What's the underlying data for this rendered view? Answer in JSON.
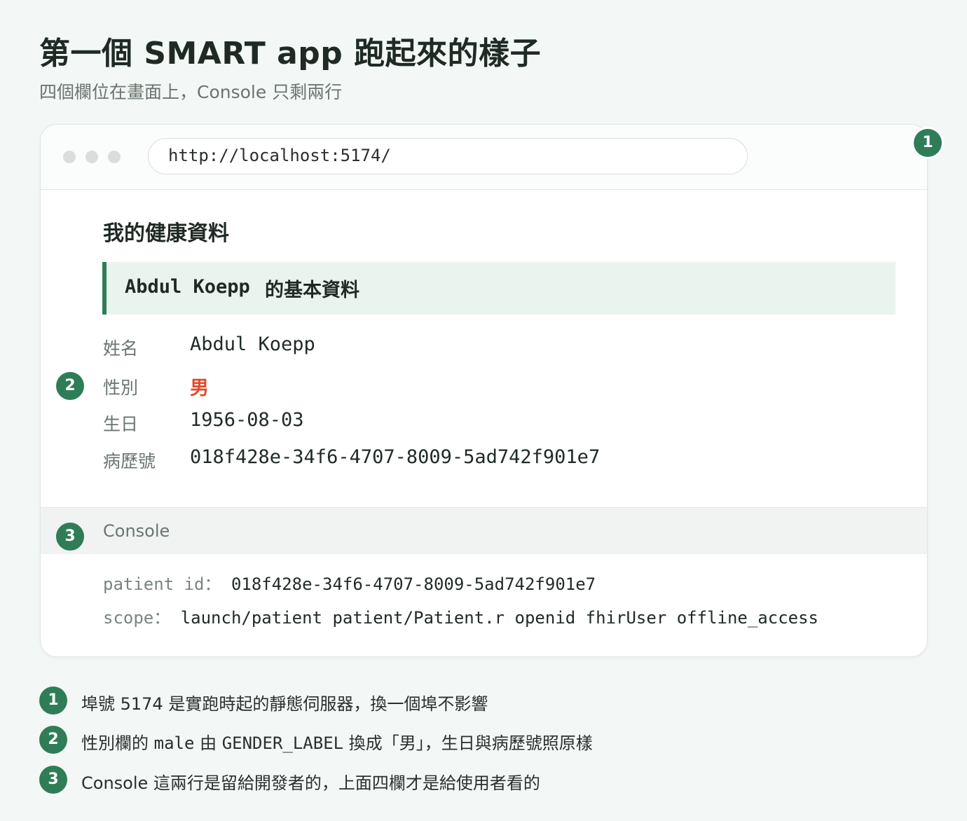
{
  "page": {
    "title": "第一個 SMART app 跑起來的樣子",
    "subtitle": "四個欄位在畫面上，Console 只剩兩行"
  },
  "browser": {
    "url": "http://localhost:5174/"
  },
  "app": {
    "heading": "我的健康資料",
    "banner_name": "Abdul Koepp",
    "banner_suffix": "的基本資料",
    "fields": [
      {
        "label": "姓名",
        "value": "Abdul Koepp"
      },
      {
        "label": "性別",
        "value": "男"
      },
      {
        "label": "生日",
        "value": "1956-08-03"
      },
      {
        "label": "病歷號",
        "value": "018f428e-34f6-4707-8009-5ad742f901e7"
      }
    ]
  },
  "console": {
    "title": "Console",
    "lines": [
      {
        "key": "patient id：",
        "value": "018f428e-34f6-4707-8009-5ad742f901e7"
      },
      {
        "key": "scope：",
        "value": "launch/patient patient/Patient.r openid fhirUser offline_access"
      }
    ]
  },
  "badges": [
    "1",
    "2",
    "3"
  ],
  "notes": [
    {
      "num": "1",
      "parts": [
        "埠號 5174 是實跑時起的靜態伺服器，換一個埠不影響"
      ]
    },
    {
      "num": "2",
      "pre": "性別欄的 ",
      "code1": "male",
      "mid": " 由 ",
      "code2": "GENDER_LABEL",
      "post": " 換成「男」，生日與病歷號照原樣"
    },
    {
      "num": "3",
      "parts": [
        "Console 這兩行是留給開發者的，上面四欄才是給使用者看的"
      ]
    }
  ],
  "colors": {
    "accent_green": "#2e7d57",
    "accent_red": "#e04a2a",
    "background": "#f3f7f5"
  }
}
